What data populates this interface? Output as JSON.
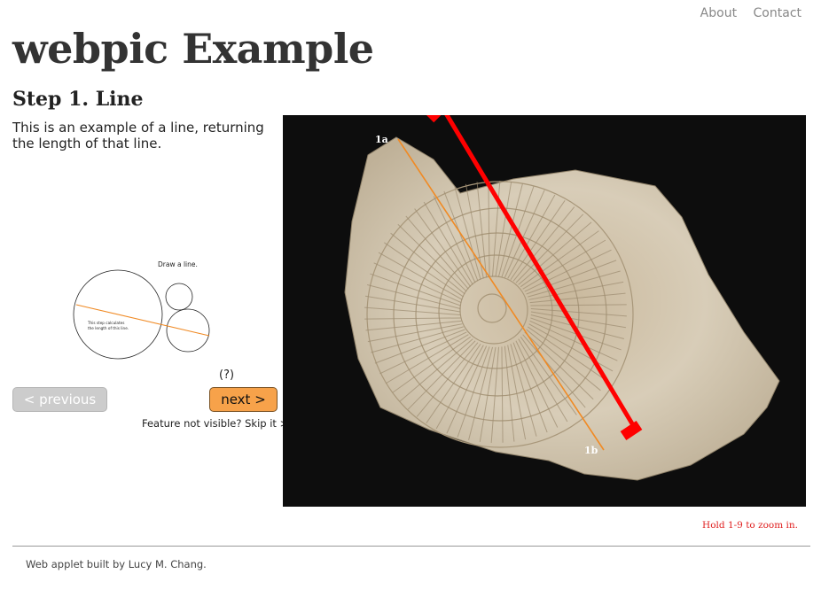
{
  "nav": {
    "about": "About",
    "contact": "Contact"
  },
  "site_title": "webpic Example",
  "step": {
    "title": "Step 1. Line",
    "description": "This is an example of a line, returning the length of that line."
  },
  "diagram": {
    "caption": "Draw a line.",
    "note_line1": "This step calculates",
    "note_line2": "the length of this line.",
    "line_color": "#f08a24"
  },
  "help_label": "(?)",
  "buttons": {
    "previous": "< previous",
    "next": "next >"
  },
  "skip": {
    "prefix": "Feature not visible?",
    "link": "Skip it >"
  },
  "photo": {
    "point_a": "1a",
    "point_b": "1b",
    "measure_line_color": "#f08a24",
    "ruler_color": "#ff0000"
  },
  "zoom_hint": "Hold 1-9 to zoom in.",
  "footer": "Web applet built by Lucy M. Chang."
}
